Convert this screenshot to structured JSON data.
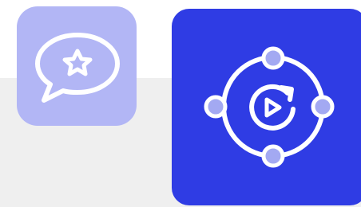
{
  "tiles": [
    {
      "name": "chat-star-app-tile",
      "icon": "chat-bubble-star-icon",
      "background": "#b2b6f5",
      "stroke": "#ffffff"
    },
    {
      "name": "replay-orbit-app-tile",
      "icon": "replay-video-orbit-icon",
      "background": "#2f3ce4",
      "stroke": "#ffffff",
      "node_fill": "#a3a9f2"
    }
  ]
}
